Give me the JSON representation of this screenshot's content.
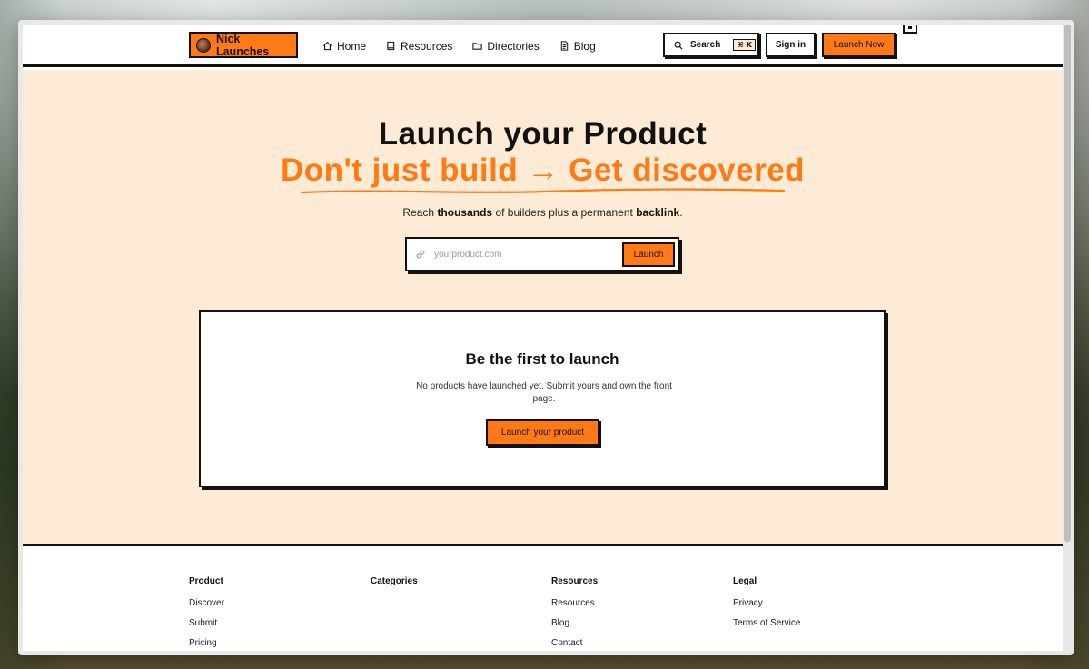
{
  "header": {
    "brand": "Nick Launches",
    "nav": [
      {
        "label": "Home",
        "icon": "home-icon"
      },
      {
        "label": "Resources",
        "icon": "book-icon"
      },
      {
        "label": "Directories",
        "icon": "folder-icon"
      },
      {
        "label": "Blog",
        "icon": "document-icon"
      }
    ],
    "search_label": "Search",
    "search_shortcut": "⌘ K",
    "signin_label": "Sign in",
    "launch_now_label": "Launch Now"
  },
  "hero": {
    "title": "Launch your Product",
    "subtitle": "Don't just build → Get discovered",
    "desc_prefix": "Reach ",
    "desc_bold1": "thousands",
    "desc_middle": " of builders plus a permanent ",
    "desc_bold2": "backlink",
    "desc_suffix": ".",
    "url_placeholder": "yourproduct.com",
    "url_value": "",
    "submit_label": "Launch"
  },
  "empty_state": {
    "title": "Be the first to launch",
    "description": "No products have launched yet. Submit yours and own the front page.",
    "cta_label": "Launch your product"
  },
  "footer": {
    "columns": [
      {
        "heading": "Product",
        "links": [
          "Discover",
          "Submit",
          "Pricing"
        ]
      },
      {
        "heading": "Categories",
        "links": []
      },
      {
        "heading": "Resources",
        "links": [
          "Resources",
          "Blog",
          "Contact"
        ]
      },
      {
        "heading": "Legal",
        "links": [
          "Privacy",
          "Terms of Service"
        ]
      }
    ]
  },
  "colors": {
    "accent": "#ff7a14",
    "hero_background": "#fdebd6",
    "border": "#111111"
  }
}
